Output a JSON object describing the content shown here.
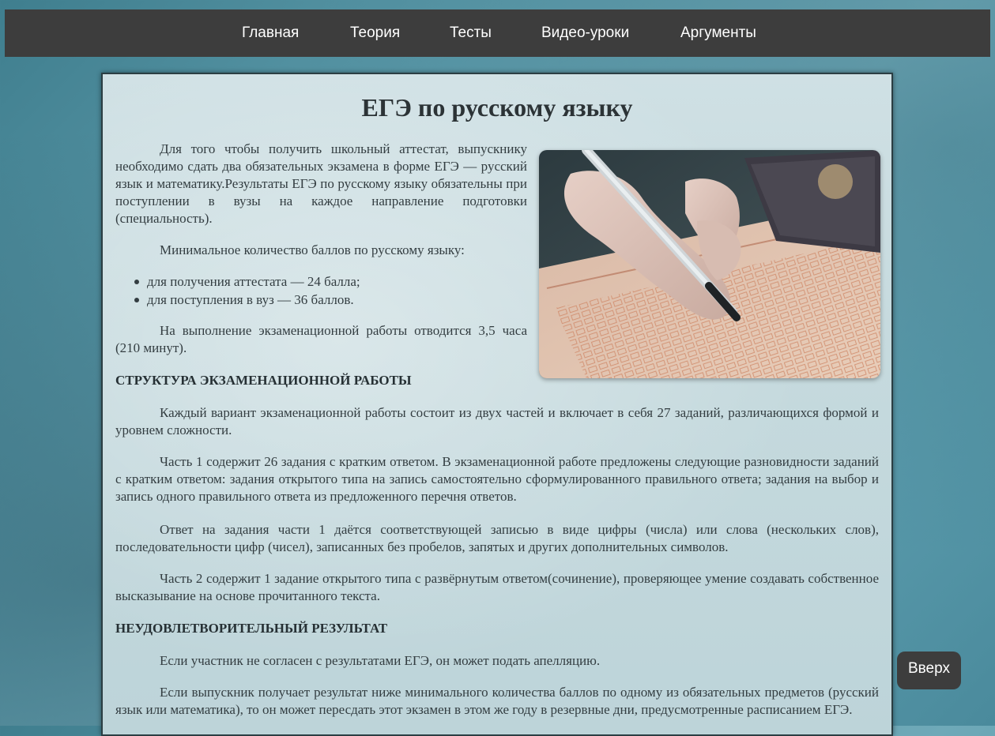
{
  "nav": {
    "items": [
      "Главная",
      "Теория",
      "Тесты",
      "Видео-уроки",
      "Аргументы"
    ]
  },
  "article": {
    "title": "ЕГЭ по русскому языку",
    "intro": "Для того чтобы получить школьный аттестат, выпускнику необходимо сдать два обязательных экзамена в форме ЕГЭ — русский язык и математику.Результаты ЕГЭ по русскому языку обязательны при поступлении в вузы на каждое направление подготовки (специальность).",
    "min_score_intro": "Минимальное количество баллов по русскому языку:",
    "min_scores": [
      "для получения аттестата — 24 балла;",
      "для поступления в вуз — 36 баллов."
    ],
    "duration": "На выполнение экзаменационной работы отводится 3,5 часа (210 минут).",
    "structure_heading": "СТРУКТУРА ЭКЗАМЕНАЦИОННОЙ РАБОТЫ",
    "structure_p1": "Каждый вариант экзаменационной работы состоит из двух частей и включает в себя 27 заданий, различающихся формой и уровнем сложности.",
    "structure_p2": "Часть 1 содержит 26 задания с кратким ответом. В экзаменационной работе предложены следующие разновидности заданий с кратким ответом: задания открытого типа на запись самостоятельно сформулированного правильного ответа; задания на выбор и запись одного правильного ответа из предложенного перечня ответов.",
    "structure_p3": "Ответ на задания части 1 даётся соответствующей записью в виде цифры (числа) или слова (нескольких слов), последовательности цифр (чисел), записанных без пробелов, запятых и других дополнительных символов.",
    "structure_p4": "Часть 2 содержит 1 задание открытого типа с развёрнутым ответом(сочинение), проверяющее умение создавать собственное высказывание на основе прочитанного текста.",
    "fail_heading": "НЕУДОВЛЕТВОРИТЕЛЬНЫЙ РЕЗУЛЬТАТ",
    "fail_p1": "Если участник не согласен с результатами ЕГЭ, он может подать апелляцию.",
    "fail_p2": "Если выпускник получает результат ниже минимального количества баллов по одному из обязательных предметов (русский язык или математика), то он может пересдать этот экзамен в этом же году в резервные дни, предусмотренные расписанием ЕГЭ."
  },
  "scroll_top": {
    "label": "Вверх"
  }
}
